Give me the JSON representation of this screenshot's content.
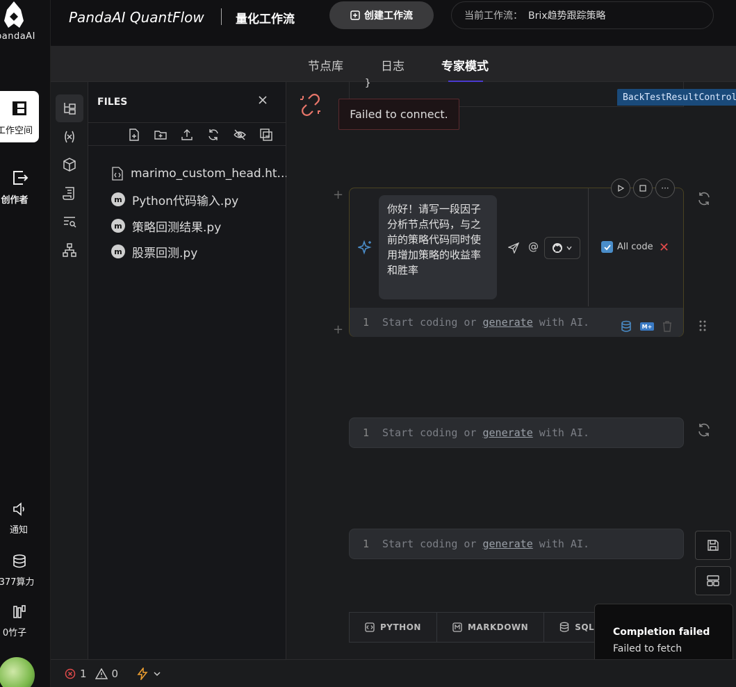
{
  "app": {
    "logo_text": "pandaAI",
    "brand": "PandaAI QuantFlow",
    "brand_sub": "量化工作流",
    "create_button": "创建工作流",
    "current_flow_label": "当前工作流：",
    "current_flow_value": "Brix趋势跟踪策略"
  },
  "rail": {
    "items": [
      {
        "label": "工作空间",
        "active": true
      },
      {
        "label": "创作者",
        "active": false
      },
      {
        "label": "通知",
        "active": false
      },
      {
        "label": "377算力",
        "active": false
      },
      {
        "label": "0竹子",
        "active": false
      }
    ]
  },
  "tabs": [
    {
      "label": "节点库",
      "active": false
    },
    {
      "label": "日志",
      "active": false
    },
    {
      "label": "专家模式",
      "active": true
    }
  ],
  "files": {
    "title": "FILES",
    "items": [
      {
        "name": "marimo_custom_head.ht...",
        "type": "html"
      },
      {
        "name": "Python代码输入.py",
        "type": "marimo"
      },
      {
        "name": "策略回测结果.py",
        "type": "marimo"
      },
      {
        "name": "股票回测.py",
        "type": "marimo"
      }
    ]
  },
  "notebook": {
    "prev_cell_brace": "}",
    "output_tag": "BackTestResultControl",
    "connect_error": "Failed to connect.",
    "ai_prompt": "你好！请写一段因子分析节点代码，与之前的策略代码同时使用增加策略的收益率和胜率",
    "at_symbol": "@",
    "all_code_label": "All code",
    "line_number": "1",
    "placeholder_start": "Start coding or ",
    "placeholder_link": "generate",
    "placeholder_end": " with AI.",
    "mplus_label": "M+",
    "cell_more": "···"
  },
  "add_bar": {
    "python": "PYTHON",
    "markdown": "MARKDOWN",
    "sql": "SQL"
  },
  "toast": {
    "title": "Completion failed",
    "message": "Failed to fetch"
  },
  "status": {
    "errors": "1",
    "warnings": "0"
  },
  "colors": {
    "accent_blue": "#4a8dc9",
    "error_red": "#e04a4a",
    "warning_orange": "#f0a030",
    "ai_cell_border": "#4a4322"
  }
}
